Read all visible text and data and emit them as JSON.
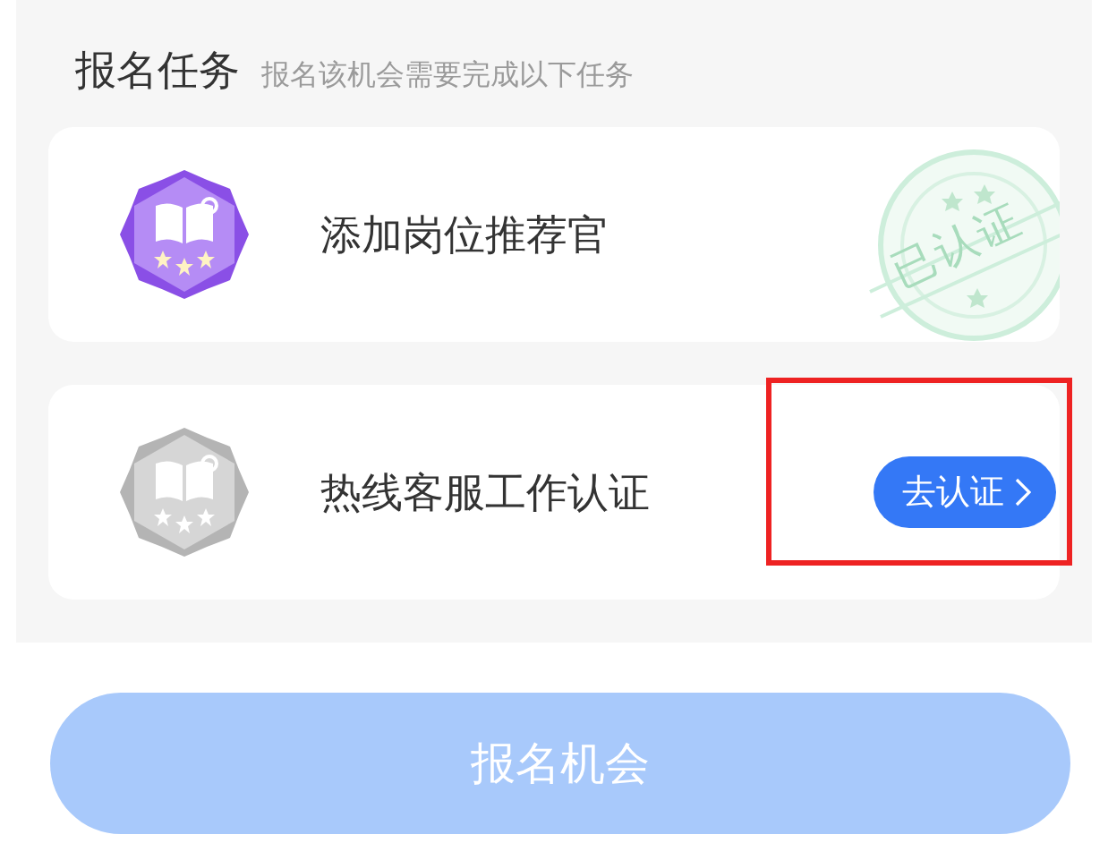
{
  "section": {
    "title": "报名任务",
    "subtitle": "报名该机会需要完成以下任务"
  },
  "tasks": [
    {
      "title": "添加岗位推荐官",
      "verified": true,
      "stamp_text": "已认证",
      "highlighted": false
    },
    {
      "title": "热线客服工作认证",
      "verified": false,
      "action_label": "去认证",
      "highlighted": true
    }
  ],
  "submit": {
    "label": "报名机会",
    "disabled": true
  }
}
